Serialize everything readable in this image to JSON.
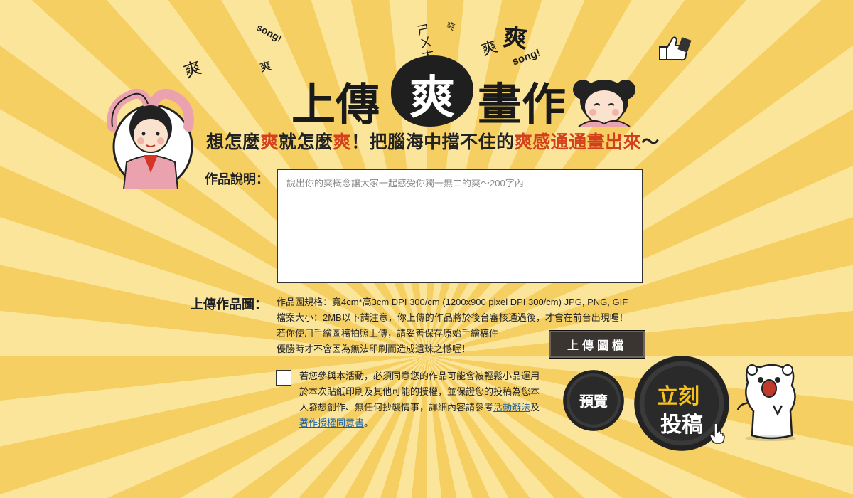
{
  "decor": {
    "shuang_small": "爽",
    "song_1": "song!",
    "song_2": "song!",
    "zhuyin": "ㄕㄨㄤ",
    "shuang_large": "爽"
  },
  "header": {
    "title_left": "上傳",
    "title_center": "爽",
    "title_right": "畫作",
    "subtitle_parts": [
      "想怎麼",
      "爽",
      "就怎麼",
      "爽",
      "！把腦海中擋不住的",
      "爽感通通畫出來",
      "～"
    ]
  },
  "form": {
    "description_label": "作品說明：",
    "description_placeholder": "說出你的爽概念讓大家一起感受你獨一無二的爽～200字內",
    "upload_label": "上傳作品圖：",
    "spec_lines": [
      "作品圖規格：寬4cm*高3cm DPI 300/cm (1200x900 pixel DPI 300/cm) JPG, PNG, GIF",
      "檔案大小：2MB以下請注意，你上傳的作品將於後台審核通過後，才會在前台出現喔！",
      "若你使用手繪圖稿拍照上傳，請妥善保存原始手繪稿件",
      "優勝時才不會因為無法印刷而造成遺珠之憾喔！"
    ],
    "upload_button": "上傳圖檔",
    "agree_text": "若您參與本活動，必須同意您的作品可能會被輕鬆小品運用於本次貼紙印刷及其他可能的授權，並保證您的投稿為您本人發想創作、無任何抄襲情事，詳細內容請參考",
    "agree_link_rules": "活動辦法",
    "agree_and": "及",
    "agree_link_license": "著作授權同意書",
    "agree_end": "。",
    "preview_button": "預覽",
    "submit_line1": "立刻",
    "submit_line2": "投稿"
  },
  "colors": {
    "accent_red": "#d2401c",
    "submit_yellow": "#f6c21f",
    "link_blue": "#1b5fa8"
  }
}
